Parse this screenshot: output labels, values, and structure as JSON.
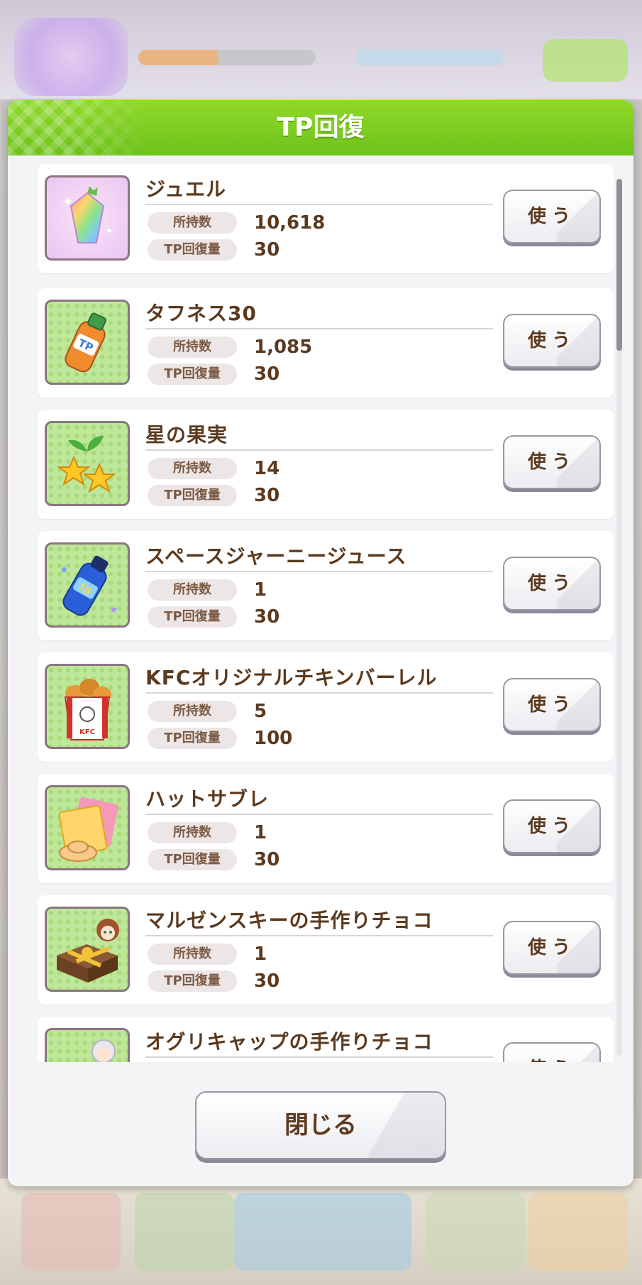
{
  "dialog": {
    "title": "TP回復",
    "close_label": "閉じる"
  },
  "labels": {
    "owned": "所持数",
    "recovery": "TP回復量",
    "use": "使う"
  },
  "items": [
    {
      "name": "ジュエル",
      "owned": "10,618",
      "recovery": "30",
      "icon": "jewel-icon"
    },
    {
      "name": "タフネス30",
      "owned": "1,085",
      "recovery": "30",
      "icon": "drink-bottle-icon"
    },
    {
      "name": "星の果実",
      "owned": "14",
      "recovery": "30",
      "icon": "star-fruit-icon"
    },
    {
      "name": "スペースジャーニージュース",
      "owned": "1",
      "recovery": "30",
      "icon": "juice-bottle-icon"
    },
    {
      "name": "KFCオリジナルチキンバーレル",
      "owned": "5",
      "recovery": "100",
      "icon": "chicken-bucket-icon"
    },
    {
      "name": "ハットサブレ",
      "owned": "1",
      "recovery": "30",
      "icon": "cookie-icon"
    },
    {
      "name": "マルゼンスキーの手作りチョコ",
      "owned": "1",
      "recovery": "30",
      "icon": "chocolate-box-icon"
    },
    {
      "name": "オグリキャップの手作りチョコ",
      "owned": "",
      "recovery": "",
      "icon": "chocolate-box-icon"
    }
  ],
  "colors": {
    "header_green": "#7ccd22",
    "text_brown": "#5b3a1f",
    "pill_bg": "#ede6e6"
  }
}
